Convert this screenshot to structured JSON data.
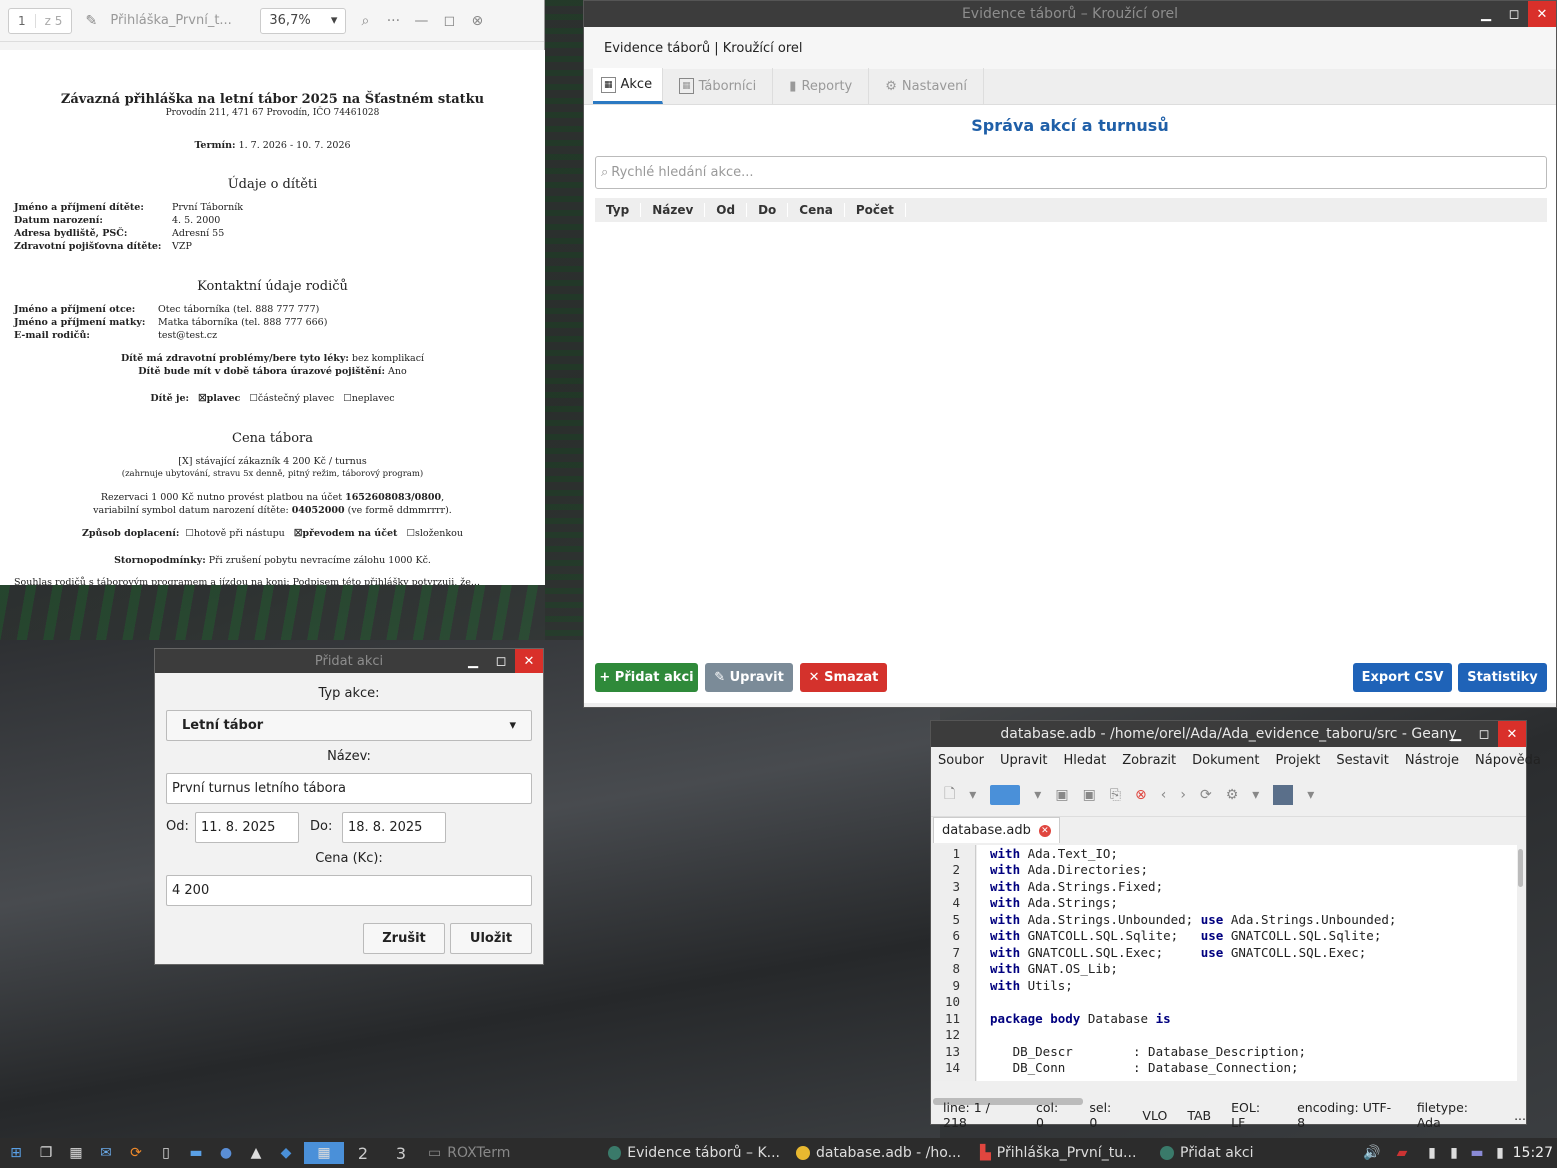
{
  "pdf_viewer": {
    "page_current": "1",
    "page_total": "z 5",
    "title": "Přihláška_První_t...",
    "zoom": "36,7%",
    "doc": {
      "title": "Závazná přihláška na letní tábor 2025 na Šťastném statku",
      "address": "Provodín 211, 471 67 Provodín, IČO 74461028",
      "term_label": "Termín:",
      "term_value": "1. 7. 2026 - 10. 7. 2026",
      "child_heading": "Údaje o dítěti",
      "child_rows": [
        {
          "label": "Jméno a příjmení dítěte:",
          "value": "První Táborník"
        },
        {
          "label": "Datum narození:",
          "value": "4. 5. 2000"
        },
        {
          "label": "Adresa bydliště, PSČ:",
          "value": "Adresní 55"
        },
        {
          "label": "Zdravotní pojišťovna dítěte:",
          "value": "VZP"
        }
      ],
      "parents_heading": "Kontaktní údaje rodičů",
      "parent_rows": [
        {
          "label": "Jméno a příjmení otce:",
          "value": "Otec táborníka (tel. 888 777 777)"
        },
        {
          "label": "Jméno a příjmení matky:",
          "value": "Matka táborníka (tel. 888 777 666)"
        },
        {
          "label": "E-mail rodičů:",
          "value": "test@test.cz"
        }
      ],
      "health_label": "Dítě má zdravotní problémy/bere tyto léky:",
      "health_value": "bez komplikací",
      "insurance_label": "Dítě bude mít v době tábora úrazové pojištění:",
      "insurance_value": "Ano",
      "swim_label": "Dítě je:",
      "swim_opt1": "☒plavec",
      "swim_opt2": "☐částečný plavec",
      "swim_opt3": "☐neplavec",
      "price_heading": "Cena tábora",
      "price_line": "[X] stávající zákazník 4 200 Kč / turnus",
      "price_note": "(zahrnuje ubytování, stravu 5x denně, pitný režim, táborový program)",
      "reservation_line1": "Rezervaci 1 000 Kč nutno provést platbou na účet",
      "reservation_account": "1652608083/0800",
      "reservation_line2": "variabilní symbol datum narození dítěte:",
      "reservation_vs": "04052000",
      "reservation_vs_note": "(ve formě ddmmrrrr).",
      "payment_label": "Způsob doplacení:",
      "payment_opt1": "☐hotově při nástupu",
      "payment_opt2": "☒převodem na účet",
      "payment_opt3": "☐složenkou",
      "storno_label": "Stornopodmínky:",
      "storno_value": "Při zrušení pobytu nevracíme zálohu 1000 Kč.",
      "cut_line": "Souhlas rodičů s táborovým programem a jízdou na koni: Podpisem této přihlášky potvrzuji, že..."
    }
  },
  "app": {
    "window_title": "Evidence táborů – Kroužící orel",
    "header": "Evidence táborů | Kroužící orel",
    "tabs": [
      {
        "label": "Akce",
        "icon": "table-icon"
      },
      {
        "label": "Táborníci",
        "icon": "table-icon"
      },
      {
        "label": "Reporty",
        "icon": "chart-icon"
      },
      {
        "label": "Nastavení",
        "icon": "gear-icon"
      }
    ],
    "heading": "Správa akcí a turnusů",
    "search_placeholder": "Rychlé hledání akce...",
    "columns": [
      "Typ",
      "Název",
      "Od",
      "Do",
      "Cena",
      "Počet"
    ],
    "buttons": {
      "add": "+ Přidat akci",
      "edit": "✎ Upravit",
      "delete": "✕ Smazat",
      "export": "Export CSV",
      "stats": "Statistiky"
    },
    "colors": {
      "accent": "#1f63b8",
      "add": "#2f8a3a",
      "delete": "#d4322c",
      "edit": "#7b8b98"
    }
  },
  "dialog": {
    "title": "Přidat akci",
    "type_label": "Typ akce:",
    "type_value": "Letní tábor",
    "name_label": "Název:",
    "name_value": "První turnus letního tábora",
    "from_label": "Od:",
    "from_value": "11. 8. 2025",
    "to_label": "Do:",
    "to_value": "18. 8. 2025",
    "price_label": "Cena (Kc):",
    "price_value": "4 200",
    "cancel": "Zrušit",
    "save": "Uložit"
  },
  "geany": {
    "title": "database.adb - /home/orel/Ada/Ada_evidence_taboru/src - Geany",
    "menu": [
      "Soubor",
      "Upravit",
      "Hledat",
      "Zobrazit",
      "Dokument",
      "Projekt",
      "Sestavit",
      "Nástroje",
      "Nápověda"
    ],
    "tab": "database.adb",
    "code": [
      {
        "n": "1",
        "kw": "with",
        "rest": " Ada.Text_IO;"
      },
      {
        "n": "2",
        "kw": "with",
        "rest": " Ada.Directories;"
      },
      {
        "n": "3",
        "kw": "with",
        "rest": " Ada.Strings.Fixed;"
      },
      {
        "n": "4",
        "kw": "with",
        "rest": " Ada.Strings;"
      },
      {
        "n": "5",
        "kw": "with",
        "rest": " Ada.Strings.Unbounded; ",
        "kw2": "use",
        "rest2": " Ada.Strings.Unbounded;"
      },
      {
        "n": "6",
        "kw": "with",
        "rest": " GNATCOLL.SQL.Sqlite;   ",
        "kw2": "use",
        "rest2": " GNATCOLL.SQL.Sqlite;"
      },
      {
        "n": "7",
        "kw": "with",
        "rest": " GNATCOLL.SQL.Exec;     ",
        "kw2": "use",
        "rest2": " GNATCOLL.SQL.Exec;"
      },
      {
        "n": "8",
        "kw": "with",
        "rest": " GNAT.OS_Lib;"
      },
      {
        "n": "9",
        "kw": "with",
        "rest": " Utils;"
      },
      {
        "n": "10",
        "kw": "",
        "rest": ""
      },
      {
        "n": "11",
        "kw": "package body",
        "rest": " Database ",
        "kw2": "is",
        "rest2": ""
      },
      {
        "n": "12",
        "kw": "",
        "rest": ""
      },
      {
        "n": "13",
        "kw": "",
        "rest": "   DB_Descr        : Database_Description;"
      },
      {
        "n": "14",
        "kw": "",
        "rest": "   DB_Conn         : Database_Connection;"
      }
    ],
    "status": [
      "line: 1 / 218",
      "col: 0",
      "sel: 0",
      "VLO",
      "TAB",
      "EOL: LF",
      "encoding: UTF-8",
      "filetype: Ada",
      "..."
    ]
  },
  "taskbar": {
    "workspaces": [
      "2",
      "3"
    ],
    "tasks": [
      "ROXTerm",
      "Evidence táborů – K...",
      "database.adb - /ho...",
      "Přihláška_První_tu...",
      "Přidat akci"
    ],
    "clock": "15:27"
  }
}
